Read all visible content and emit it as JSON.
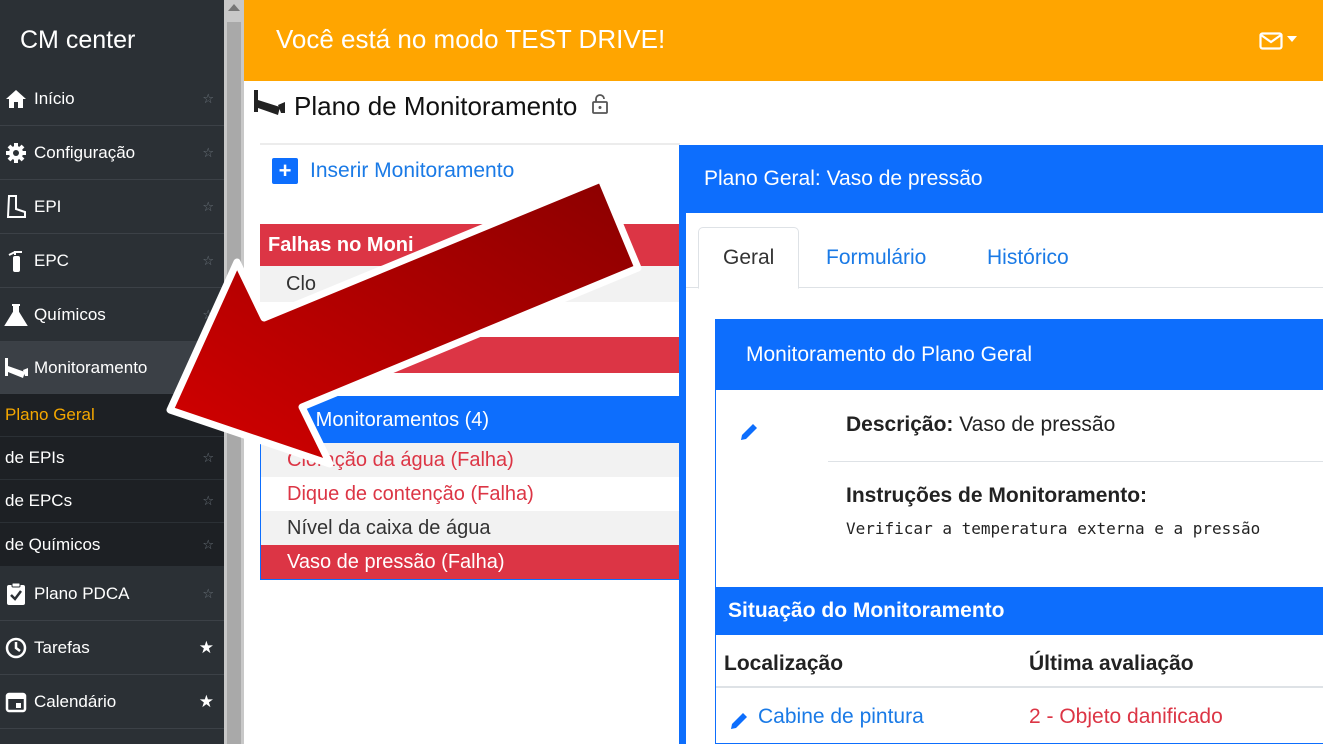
{
  "app": {
    "brand": "CM center"
  },
  "sidebar": {
    "items": [
      {
        "label": "Início",
        "icon": "home-icon",
        "star": "☆",
        "starred": false
      },
      {
        "label": "Configuração",
        "icon": "gear-icon",
        "star": "☆",
        "starred": false
      },
      {
        "label": "EPI",
        "icon": "boot-icon",
        "star": "☆",
        "starred": false
      },
      {
        "label": "EPC",
        "icon": "extinguisher-icon",
        "star": "☆",
        "starred": false
      },
      {
        "label": "Químicos",
        "icon": "flask-icon",
        "star": "☆",
        "starred": false
      },
      {
        "label": "Monitoramento",
        "icon": "camera-icon",
        "star": "",
        "starred": false
      }
    ],
    "subitems": [
      {
        "label": "Plano Geral",
        "star": "",
        "selected": true
      },
      {
        "label": "de EPIs",
        "star": "☆",
        "selected": false
      },
      {
        "label": "de EPCs",
        "star": "☆",
        "selected": false
      },
      {
        "label": "de Químicos",
        "star": "☆",
        "selected": false
      }
    ],
    "bottom_items": [
      {
        "label": "Plano PDCA",
        "icon": "clipboard-check-icon",
        "star": "☆",
        "starred": false
      },
      {
        "label": "Tarefas",
        "icon": "clock-icon",
        "star": "★",
        "starred": true
      },
      {
        "label": "Calendário",
        "icon": "calendar-icon",
        "star": "★",
        "starred": true
      }
    ]
  },
  "topbar": {
    "message": "Você está no modo TEST DRIVE!",
    "mail_icon": "mail-icon"
  },
  "page": {
    "title": "Plano de Monitoramento"
  },
  "left": {
    "insert_label": "Inserir Monitoramento",
    "failures_title": "Falhas no Moni",
    "failures_row": "Clo",
    "failures_red_row": "são",
    "monitorings_title": "os Monitoramentos (4)",
    "monitorings": [
      {
        "label": "Cloração da água (Falha)",
        "state": "fail"
      },
      {
        "label": "Dique de contenção (Falha)",
        "state": "fail"
      },
      {
        "label": "Nível da caixa de água",
        "state": "ok"
      },
      {
        "label": "Vaso de pressão (Falha)",
        "state": "selected"
      }
    ]
  },
  "right": {
    "title": "Plano Geral: Vaso de pressão",
    "tabs": [
      "Geral",
      "Formulário",
      "Histórico"
    ],
    "card_title": "Monitoramento do Plano Geral",
    "desc_label": "Descrição:",
    "desc_value": " Vaso de pressão",
    "instr_label": "Instruções de Monitoramento:",
    "instr_text": "Verificar a temperatura externa e a pressão",
    "situation_title": "Situação do Monitoramento",
    "col_location": "Localização",
    "col_last": "Última avaliação",
    "row_location": "Cabine de pintura",
    "row_last": "2 - Objeto danificado"
  },
  "colors": {
    "accent": "#0d6efd",
    "danger": "#dc3545",
    "warning": "#ffa500",
    "sidebar": "#2b3035",
    "arrow": "#a00000"
  }
}
